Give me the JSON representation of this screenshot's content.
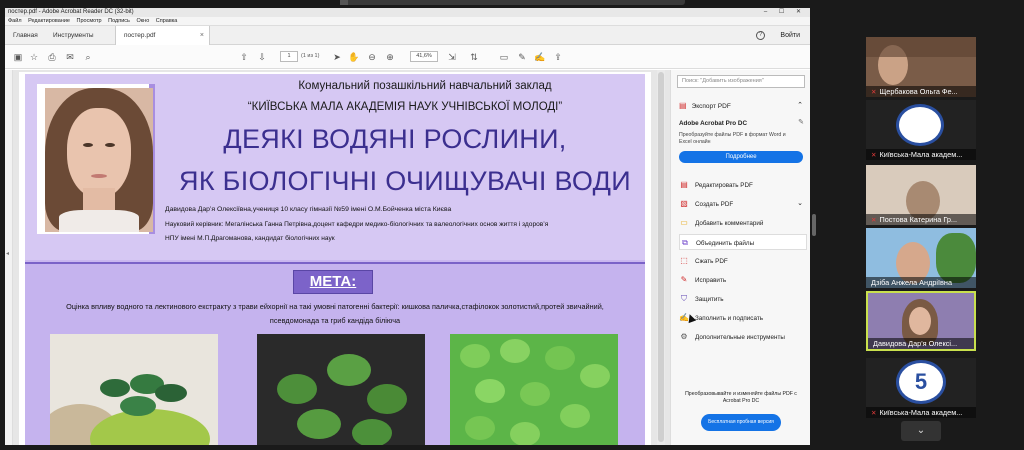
{
  "window": {
    "title": "постер.pdf - Adobe Acrobat Reader DC (32-bit)",
    "controls": "– ☐ ✕"
  },
  "menu": [
    "Файл",
    "Редактирование",
    "Просмотр",
    "Подпись",
    "Окно",
    "Справка"
  ],
  "tabs": {
    "home": "Главная",
    "tools": "Инструменты",
    "document": "постер.pdf",
    "close_symbol": "×"
  },
  "header": {
    "help_symbol": "?",
    "signin": "Войти"
  },
  "toolbar": {
    "page_current": "1",
    "page_count": "(1 из 1)",
    "zoom": "41,6%"
  },
  "poster": {
    "institution_line1": "Комунальний позашкільний навчальний заклад",
    "institution_line2": "“КИЇВСЬКА МАЛА АКАДЕМІЯ НАУК УЧНІВСЬКОЇ МОЛОДІ”",
    "title_line1": "ДЕЯКІ ВОДЯНІ РОСЛИНИ,",
    "title_line2": "ЯК БІОЛОГІЧНІ ОЧИЩУВАЧІ ВОДИ",
    "author": "Давидова Дар’я Олексіївна,учениця 10 класу гімназії №59 імені О.М.Бойченка міста Києва",
    "advisor_line1": "Науковий керівник:  Мегалінська Ганна Петрівна,доцент кафедри медико-біологічних та валеологічних основ життя і здоров’я",
    "advisor_line2": "НПУ імені М.П.Драгоманова, кандидат біологічних наук",
    "meta_heading": "МЕТА:",
    "meta_line1": "Оцінка впливу водного та лектинового екстракту з трави ейхорнії на такі умовні патогенні бактерії: кишкова паличка,стафілокок золотистий,протей звичайний,",
    "meta_line2": "псевдомонада та гриб кандіда біліюча"
  },
  "right_panel": {
    "search_placeholder": "Поиск: \"Добавить изображения\"",
    "export_pdf": "Экспорт PDF",
    "acrobat_pro": "Adobe Acrobat Pro DC",
    "acrobat_desc": "Преобразуйте файлы PDF в формат Word и Excel онлайн",
    "details_button": "Подробнее",
    "tools": [
      {
        "label": "Редактировать PDF",
        "icon": "edit-pdf-icon",
        "glyph": "▤"
      },
      {
        "label": "Создать PDF",
        "icon": "create-pdf-icon",
        "glyph": "▧"
      },
      {
        "label": "Добавить комментарий",
        "icon": "comment-icon",
        "glyph": "▭"
      },
      {
        "label": "Объединить файлы",
        "icon": "combine-files-icon",
        "glyph": "⧉"
      },
      {
        "label": "Сжать PDF",
        "icon": "compress-pdf-icon",
        "glyph": "⬚"
      },
      {
        "label": "Исправить",
        "icon": "fix-icon",
        "glyph": "✎"
      },
      {
        "label": "Защитить",
        "icon": "protect-shield-icon",
        "glyph": "⛉"
      },
      {
        "label": "Заполнить и подписать",
        "icon": "fill-sign-icon",
        "glyph": "✍"
      },
      {
        "label": "Дополнительные инструменты",
        "icon": "more-tools-icon",
        "glyph": "⚙"
      }
    ],
    "promo": "Преобразовывайте и изменяйте файлы PDF с Acrobat Pro DC",
    "trial_button": "Бесплатная пробная версия"
  },
  "participants": [
    {
      "name": "Щербакова Ольга Фе...",
      "muted": true,
      "kind": "camera",
      "bg": "#8a6b55"
    },
    {
      "name": "Київська-Мала академ...",
      "muted": true,
      "kind": "logo",
      "bg": "#ffffff"
    },
    {
      "name": "Постова Катерина Гр...",
      "muted": true,
      "kind": "camera",
      "bg": "#b89a80"
    },
    {
      "name": "Дзіба Анжела Андріївна",
      "muted": false,
      "kind": "camera",
      "bg": "#6f9fc4"
    },
    {
      "name": "Давидова Дар'я Олексі...",
      "muted": false,
      "kind": "camera",
      "bg": "#9a86b8"
    },
    {
      "name": "Київська-Мала академ...",
      "muted": true,
      "kind": "logo",
      "bg": "#ffffff"
    }
  ],
  "colors": {
    "poster_title": "#3b2f8f",
    "poster_bg": "#d6c8f3",
    "meta_badge": "#7c63c9",
    "acrobat_blue": "#1473e6",
    "active_speaker": "#c9e04d"
  }
}
